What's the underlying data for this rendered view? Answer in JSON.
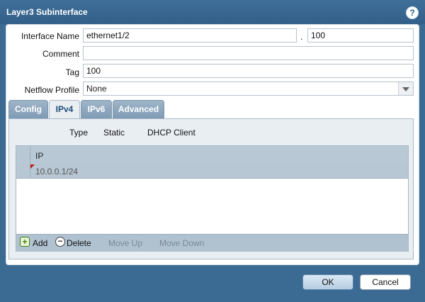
{
  "dialog": {
    "title": "Layer3 Subinterface",
    "help_label": "?"
  },
  "form": {
    "interface_name_label": "Interface Name",
    "interface_name_value": "ethernet1/2",
    "separator": ".",
    "subinterface_value": "100",
    "comment_label": "Comment",
    "comment_value": "",
    "tag_label": "Tag",
    "tag_value": "100",
    "netflow_label": "Netflow Profile",
    "netflow_value": "None"
  },
  "tabs": [
    {
      "label": "Config",
      "active": false
    },
    {
      "label": "IPv4",
      "active": true
    },
    {
      "label": "IPv6",
      "active": false
    },
    {
      "label": "Advanced",
      "active": false
    }
  ],
  "ipv4": {
    "type_label": "Type",
    "options": [
      "Static",
      "DHCP Client"
    ],
    "grid": {
      "column": "IP",
      "rows": [
        "10.0.0.1/24"
      ]
    },
    "actions": {
      "add": "Add",
      "delete": "Delete",
      "move_up": "Move Up",
      "move_down": "Move Down"
    }
  },
  "footer": {
    "ok": "OK",
    "cancel": "Cancel"
  }
}
